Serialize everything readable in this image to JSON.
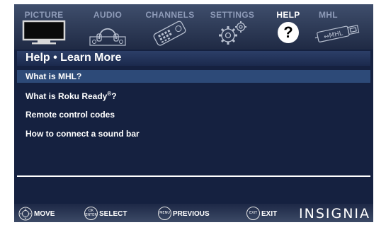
{
  "tabs": [
    {
      "label": "PICTURE",
      "icon": "tv-icon",
      "active": false
    },
    {
      "label": "AUDIO",
      "icon": "headphones-icon",
      "active": false
    },
    {
      "label": "CHANNELS",
      "icon": "remote-icon",
      "active": false
    },
    {
      "label": "SETTINGS",
      "icon": "gears-icon",
      "active": false
    },
    {
      "label": "HELP",
      "icon": "question-icon",
      "active": true
    },
    {
      "label": "MHL",
      "icon": "mhl-cable-icon",
      "active": false
    }
  ],
  "panel": {
    "title": "Help • Learn More",
    "items": [
      {
        "label": "What is MHL?",
        "selected": true
      },
      {
        "label": "What is Roku Ready",
        "sup": "®",
        "suffix": "?",
        "selected": false
      },
      {
        "label": "Remote control codes",
        "selected": false
      },
      {
        "label": "How to connect a sound bar",
        "selected": false
      }
    ]
  },
  "hints": [
    {
      "key": "",
      "label": "MOVE",
      "icon": "dpad-icon"
    },
    {
      "key_top": "OK",
      "key_bottom": "ENTER",
      "label": "SELECT"
    },
    {
      "key": "MENU",
      "label": "PREVIOUS"
    },
    {
      "key": "EXIT",
      "label": "EXIT"
    }
  ],
  "brand": "INSIGNIA",
  "colors": {
    "tab_bar": "#2c3a58",
    "panel_bg": "#152140",
    "selected_row": "#2d4a78",
    "text": "#ffffff",
    "inactive_tab_text": "#8e9bb8"
  }
}
